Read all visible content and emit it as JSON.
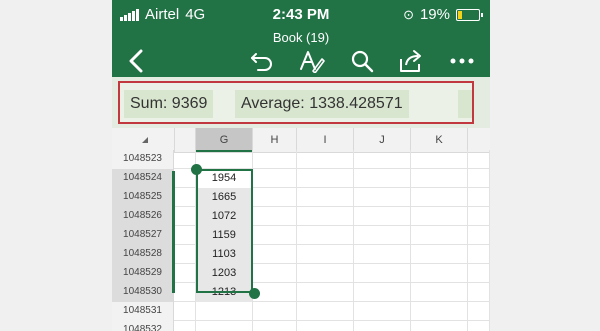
{
  "status": {
    "carrier": "Airtel",
    "network": "4G",
    "time": "2:43 PM",
    "battery": "19%"
  },
  "title": "Book (19)",
  "icons": [
    "back-icon",
    "undo-icon",
    "text-format-icon",
    "search-icon",
    "share-icon",
    "more-icon"
  ],
  "summary": {
    "sum": "Sum: 9369",
    "average": "Average: 1338.428571"
  },
  "columns": [
    "G",
    "H",
    "I",
    "J",
    "K"
  ],
  "rows": [
    {
      "num": "1048523",
      "value": ""
    },
    {
      "num": "1048524",
      "value": "1954"
    },
    {
      "num": "1048525",
      "value": "1665"
    },
    {
      "num": "1048526",
      "value": "1072"
    },
    {
      "num": "1048527",
      "value": "1159"
    },
    {
      "num": "1048528",
      "value": "1103"
    },
    {
      "num": "1048529",
      "value": "1203"
    },
    {
      "num": "1048530",
      "value": "1213"
    },
    {
      "num": "1048531",
      "value": ""
    },
    {
      "num": "1048532",
      "value": ""
    }
  ],
  "colors": {
    "accent": "#217346",
    "highlight": "#c1383f"
  }
}
